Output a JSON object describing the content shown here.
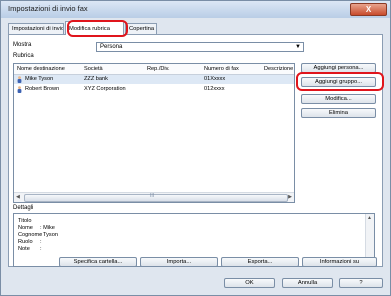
{
  "window": {
    "title": "Impostazioni di invio fax",
    "close_label": "X"
  },
  "tabs": [
    {
      "label": "Impostazioni di invio"
    },
    {
      "label": "Modifica rubrica"
    },
    {
      "label": "Copertina"
    }
  ],
  "filter": {
    "label": "Mostra",
    "value": "Persona"
  },
  "address_book": {
    "label": "Rubrica",
    "columns": [
      "Nome destinazione",
      "Società",
      "Rep./Div.",
      "Numero di fax",
      "Descrizione"
    ],
    "rows": [
      {
        "name": "Mike Tyson",
        "company": "ZZZ bank",
        "dept": "",
        "fax": "01Xxxxx",
        "desc": ""
      },
      {
        "name": "Robert Brown",
        "company": "XYZ Corporation",
        "dept": "",
        "fax": "012xxxx",
        "desc": ""
      }
    ],
    "scroll_thumb_glyph": "III"
  },
  "side_buttons": {
    "add_person": "Aggiungi persona...",
    "add_group": "Aggiungi gruppo...",
    "edit": "Modifica...",
    "delete": "Elimina"
  },
  "details": {
    "label": "Dettagli",
    "title_label": "Titolo",
    "name_label": "Nome",
    "name_value": ": Mike",
    "surname_label": "Cognome",
    "surname_value": ": Tyson",
    "role_label": "Ruolo",
    "role_value": ":",
    "notes_label": "Note",
    "notes_value": ":"
  },
  "bottom_buttons": {
    "specify_folder": "Specifica cartella...",
    "import": "Importa...",
    "export": "Esporta...",
    "info": "Informazioni su"
  },
  "dialog_buttons": {
    "ok": "OK",
    "cancel": "Annulla",
    "help": "?"
  },
  "colors": {
    "highlight": "#e0151c",
    "selected_row": "#dde8f5"
  }
}
